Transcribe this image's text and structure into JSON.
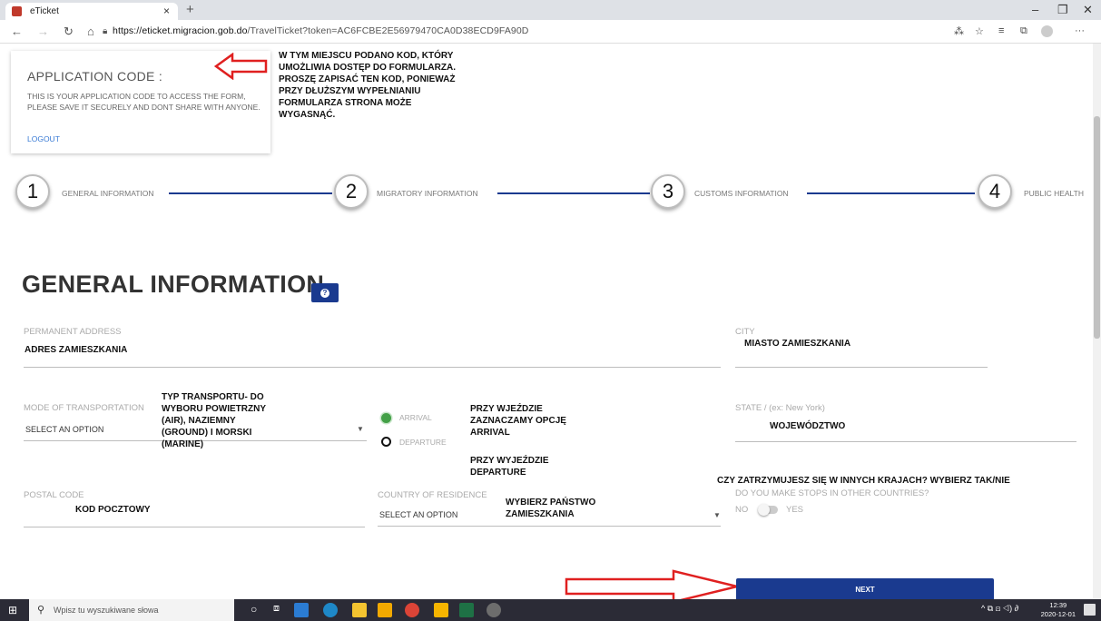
{
  "browser": {
    "tab_title": "eTicket",
    "url_host": "https://eticket.migracion.gob.do",
    "url_path": "/TravelTicket?token=AC6FCBE2E56979470CA0D38ECD9FA90D"
  },
  "app_code": {
    "title": "APPLICATION CODE :",
    "description": "THIS IS YOUR APPLICATION CODE TO ACCESS THE FORM, PLEASE SAVE IT SECURELY AND DONT SHARE WITH ANYONE.",
    "logout": "LOGOUT"
  },
  "annotations": {
    "code_note": "W TYM MIEJSCU PODANO KOD, KTÓRY UMOŻLIWIA DOSTĘP DO FORMULARZA. PROSZĘ ZAPISAĆ TEN KOD, PONIEWAŻ PRZY DŁUŻSZYM WYPEŁNIANIU FORMULARZA STRONA MOŻE WYGASNĄĆ.",
    "transport_note": "TYP TRANSPORTU- DO WYBORU POWIETRZNY (AIR), NAZIEMNY (GROUND) I MORSKI (MARINE)",
    "arrival_note": "PRZY WJEŹDZIE ZAZNACZAMY OPCJĘ ARRIVAL",
    "departure_note": "PRZY WYJEŹDZIE DEPARTURE",
    "country_note": "WYBIERZ PAŃSTWO ZAMIESZKANIA",
    "stops_note": "CZY ZATRZYMUJESZ SIĘ W INNYCH KRAJACH? WYBIERZ TAK/NIE"
  },
  "steps": [
    {
      "num": "1",
      "label": "GENERAL INFORMATION"
    },
    {
      "num": "2",
      "label": "MIGRATORY INFORMATION"
    },
    {
      "num": "3",
      "label": "CUSTOMS INFORMATION"
    },
    {
      "num": "4",
      "label": "PUBLIC HEALTH"
    }
  ],
  "form": {
    "heading": "GENERAL INFORMATION",
    "permanent_address": {
      "label": "PERMANENT ADDRESS",
      "value": "ADRES ZAMIESZKANIA"
    },
    "city": {
      "label": "CITY",
      "value": "MIASTO ZAMIESZKANIA"
    },
    "mode": {
      "label": "MODE OF TRANSPORTATION",
      "value": "SELECT AN OPTION"
    },
    "arrival": "ARRIVAL",
    "departure": "DEPARTURE",
    "state": {
      "label": "STATE / (ex: New York)",
      "value": "WOJEWÓDZTWO"
    },
    "postal": {
      "label": "POSTAL CODE",
      "value": "KOD POCZTOWY"
    },
    "country": {
      "label": "COUNTRY OF RESIDENCE",
      "value": "SELECT AN OPTION"
    },
    "stops": {
      "label": "DO YOU MAKE STOPS IN OTHER COUNTRIES?",
      "no": "NO",
      "yes": "YES"
    },
    "next": "NEXT"
  },
  "taskbar": {
    "search_placeholder": "Wpisz tu wyszukiwane słowa",
    "time": "12:39",
    "date": "2020-12-01"
  },
  "colors": {
    "accent": "#1a3a8f",
    "annotation": "#e02020"
  }
}
